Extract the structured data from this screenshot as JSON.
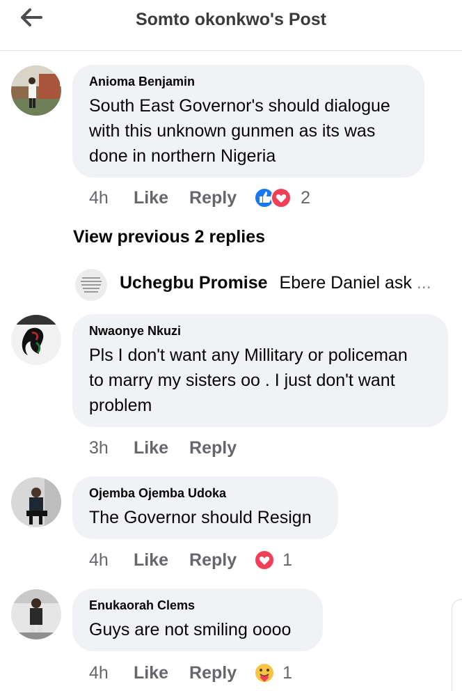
{
  "header": {
    "title": "Somto okonkwo's Post"
  },
  "comments": [
    {
      "author": "Anioma Benjamin",
      "text_lines": [
        "South East Governor's should dialogue",
        "with this unknown gunmen as its was",
        "done in northern Nigeria"
      ],
      "time": "4h",
      "like": "Like",
      "reply": "Reply",
      "reactions": [
        "like-reaction",
        "love-reaction"
      ],
      "reaction_count": "2"
    },
    {
      "author": "Nwaonye Nkuzi",
      "text_lines": [
        "Pls I don't want any Millitary or policeman",
        "to marry my sisters oo . I just don't want",
        "problem"
      ],
      "time": "3h",
      "like": "Like",
      "reply": "Reply"
    },
    {
      "author": "Ojemba Ojemba Udoka",
      "text_lines": [
        "The Governor should Resign"
      ],
      "time": "4h",
      "like": "Like",
      "reply": "Reply",
      "reactions": [
        "love-reaction"
      ],
      "reaction_count": "1"
    },
    {
      "author": "Enukaorah Clems",
      "text_lines": [
        "Guys are not smiling oooo"
      ],
      "time": "4h",
      "like": "Like",
      "reply": "Reply",
      "reactions": [
        "care-reaction"
      ],
      "reaction_count": "1"
    }
  ],
  "replies": {
    "view_previous": "View previous 2 replies",
    "preview_author": "Uchegbu Promise",
    "preview_text": "Ebere Daniel ask",
    "preview_ellipsis": "..."
  },
  "colors": {
    "bubble": "#f0f2f5",
    "meta": "#65676b",
    "like_blue": "#1877f2",
    "love_red": "#f33e58"
  }
}
